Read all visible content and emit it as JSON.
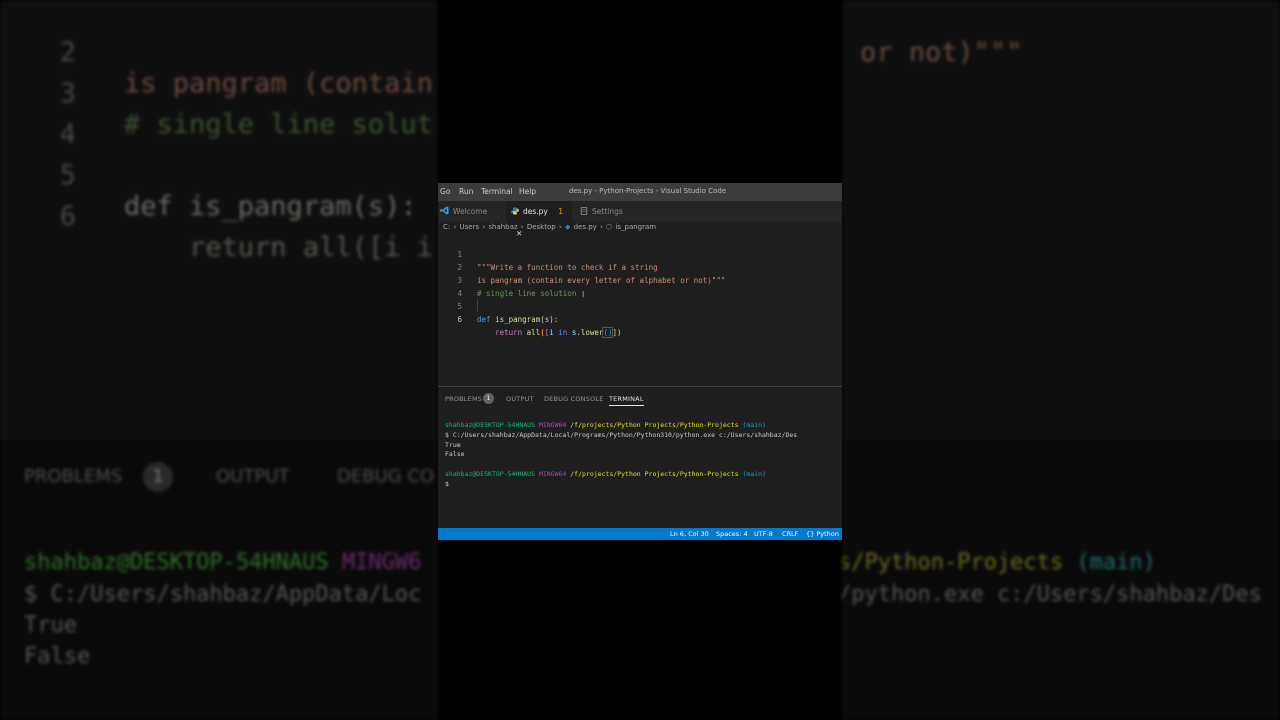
{
  "background": {
    "editor_lines": [
      {
        "num": "2",
        "text": "is pangram (contain",
        "text_right": "or not)\"\"\""
      },
      {
        "num": "3",
        "text": "# single line solut",
        "text_right": ""
      },
      {
        "num": "4",
        "text": "",
        "text_right": ""
      },
      {
        "num": "5",
        "text": "def is_pangram(s):",
        "text_right": ""
      },
      {
        "num": "6",
        "text": "    return all([i i",
        "text_right": ""
      }
    ],
    "panel_tabs": {
      "problems": "PROBLEMS",
      "problems_count": "1",
      "output": "OUTPUT",
      "debug": "DEBUG CO"
    },
    "terminal": {
      "prompt_user": "shahbaz@DESKTOP-54HNAUS",
      "prompt_env": "MINGW6",
      "prompt_path_right": "s/Python-Projects",
      "prompt_branch": "(main)",
      "cmd_left": "$ C:/Users/shahbaz/AppData/Loc",
      "cmd_right": "/python.exe c:/Users/shahbaz/Des",
      "out1": "True",
      "out2": "False"
    }
  },
  "menu": [
    "Go",
    "Run",
    "Terminal",
    "Help"
  ],
  "window_title": "des.py - Python-Projects - Visual Studio Code",
  "tabs": [
    {
      "label": "Welcome",
      "icon": "vscode-icon"
    },
    {
      "label": "des.py",
      "badge": "1",
      "icon": "python-icon",
      "active": true
    },
    {
      "label": "Settings",
      "icon": "settings-file-icon"
    }
  ],
  "breadcrumb": [
    "C:",
    "Users",
    "shahbaz",
    "Desktop",
    "des.py",
    "is_pangram"
  ],
  "code": {
    "l1": "\"\"\"Write a function to check if a string",
    "l2": "is pangram (contain every letter of alphabet or not)\"\"\"",
    "l3": "# single line solution",
    "l5_kw": "def",
    "l5_fn": "is_pangram",
    "l5_open": "(",
    "l5_param": "s",
    "l5_close": "):",
    "l6_kw": "return",
    "l6_fn": "all",
    "l6_p1": "(",
    "l6_b1": "[",
    "l6_var": "i",
    "l6_in": "in",
    "l6_obj": "s",
    "l6_dot": ".",
    "l6_meth": "lower",
    "l6_p2": "()",
    "l6_b2": "])",
    "line_numbers": [
      "1",
      "2",
      "3",
      "4",
      "5",
      "6"
    ]
  },
  "panel": {
    "problems": "PROBLEMS",
    "problems_count": "1",
    "output": "OUTPUT",
    "debug_console": "DEBUG CONSOLE",
    "terminal": "TERMINAL"
  },
  "terminal": {
    "user": "shahbaz@DESKTOP-54HNAUS",
    "env": "MINGW64",
    "path": "/f/projects/Python Projects/Python-Projects",
    "branch": "(main)",
    "cmd": "$ C:/Users/shahbaz/AppData/Local/Programs/Python/Python310/python.exe c:/Users/shahbaz/Des",
    "out1": "True",
    "out2": "False",
    "prompt": "$"
  },
  "status": {
    "position": "Ln 6, Col 30",
    "spaces": "Spaces: 4",
    "encoding": "UTF-8",
    "eol": "CRLF",
    "language": "Python"
  },
  "colors": {
    "statusbar": "#007acc",
    "editor_bg": "#1e1e1e",
    "titlebar": "#3c3c3c"
  }
}
